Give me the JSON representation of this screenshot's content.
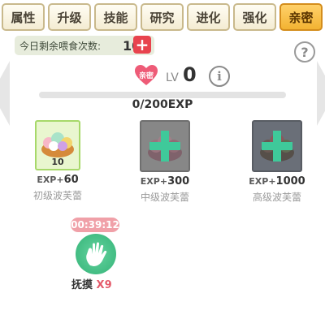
{
  "tabs": [
    "属性",
    "升级",
    "技能",
    "研究",
    "进化",
    "强化",
    "亲密"
  ],
  "active_tab": "亲密",
  "feed": {
    "label": "今日剩余喂食次数:",
    "count": "10",
    "add_symbol": "+"
  },
  "help_symbol": "?",
  "intimacy": {
    "heart_label": "亲密",
    "lv_label": "LV",
    "lv_value": "0",
    "info_symbol": "i"
  },
  "exp": {
    "text": "0/200EXP",
    "progress": 0
  },
  "foods": [
    {
      "name": "初级波芙蕾",
      "exp_prefix": "EXP+",
      "exp_value": "60",
      "quantity": "10"
    },
    {
      "name": "中级波芙蕾",
      "exp_prefix": "EXP+",
      "exp_value": "300"
    },
    {
      "name": "高级波芙蕾",
      "exp_prefix": "EXP+",
      "exp_value": "1000"
    }
  ],
  "pet_action": {
    "timer": "00:39:12",
    "label": "抚摸",
    "multiplier": "X9"
  },
  "colors": {
    "active_tab": "#f3b332",
    "heart": "#ee5b77",
    "plus_button": "#e8434e",
    "pet_button": "#34b377",
    "green_plus": "#3fc99a"
  }
}
